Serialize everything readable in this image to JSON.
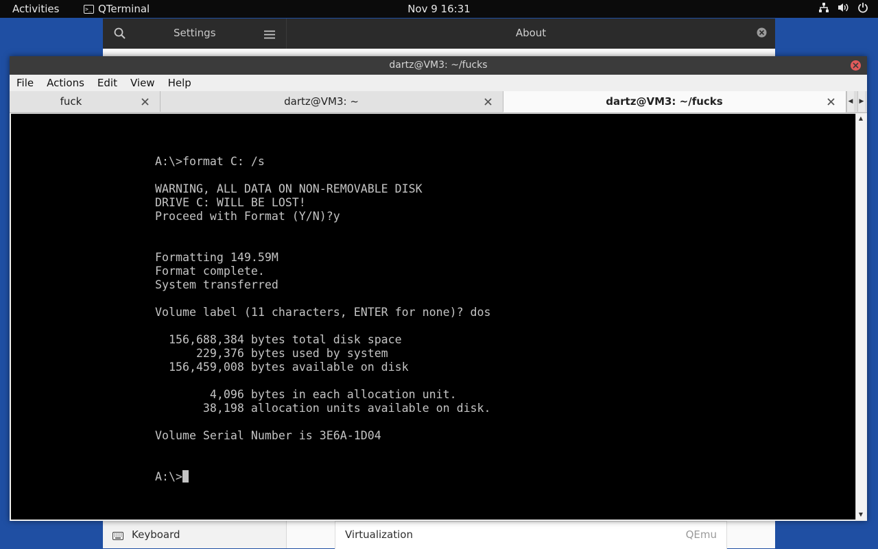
{
  "topbar": {
    "activities": "Activities",
    "app_name": "QTerminal",
    "clock": "Nov 9  16:31",
    "icons": [
      "network-icon",
      "volume-icon",
      "power-icon"
    ]
  },
  "settings": {
    "title": "Settings",
    "panel_title": "About",
    "sidebar_item": "Keyboard",
    "row_label": "Virtualization",
    "row_value": "QEmu"
  },
  "terminal": {
    "window_title": "dartz@VM3: ~/fucks",
    "menu": [
      "File",
      "Actions",
      "Edit",
      "View",
      "Help"
    ],
    "tabs": [
      {
        "label": "fuck",
        "active": false
      },
      {
        "label": "dartz@VM3: ~",
        "active": false
      },
      {
        "label": "dartz@VM3: ~/fucks",
        "active": true
      }
    ],
    "lines": [
      "A:\\>format C: /s",
      "",
      "WARNING, ALL DATA ON NON-REMOVABLE DISK",
      "DRIVE C: WILL BE LOST!",
      "Proceed with Format (Y/N)?y",
      "",
      "",
      "Formatting 149.59M",
      "Format complete.",
      "System transferred",
      "",
      "Volume label (11 characters, ENTER for none)? dos",
      "",
      "  156,688,384 bytes total disk space",
      "      229,376 bytes used by system",
      "  156,459,008 bytes available on disk",
      "",
      "        4,096 bytes in each allocation unit.",
      "       38,198 allocation units available on disk.",
      "",
      "Volume Serial Number is 3E6A-1D04",
      "",
      ""
    ],
    "prompt": "A:\\>"
  }
}
